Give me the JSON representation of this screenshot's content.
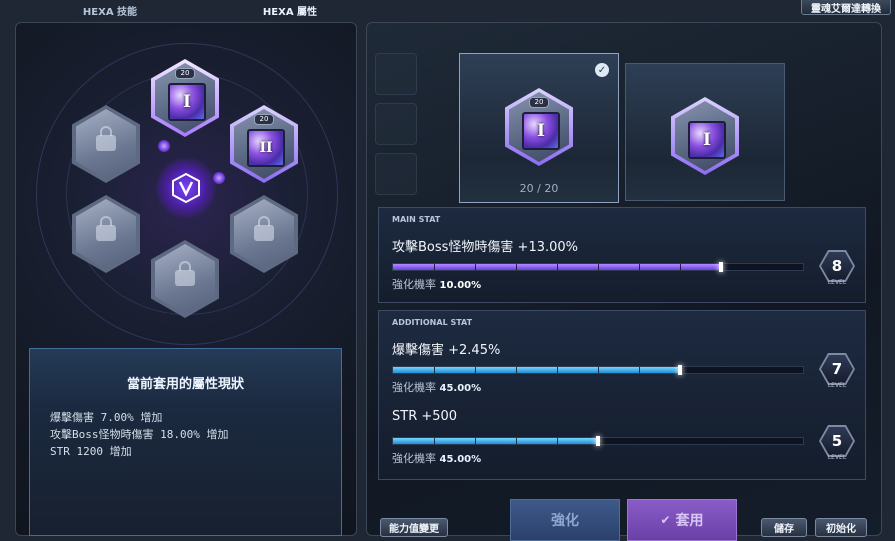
{
  "tabs": [
    {
      "label": "HEXA 技能",
      "active": false
    },
    {
      "label": "HEXA 屬性",
      "active": true
    }
  ],
  "top_button": "靈魂艾爾達轉換",
  "nodes": [
    {
      "state": "selected",
      "level": "20",
      "numeral": "I"
    },
    {
      "state": "active",
      "level": "20",
      "numeral": "II"
    },
    {
      "state": "locked"
    },
    {
      "state": "locked"
    },
    {
      "state": "locked"
    },
    {
      "state": "locked"
    }
  ],
  "current_stats": {
    "title": "當前套用的屬性現狀",
    "lines": [
      "爆擊傷害 7.00% 增加",
      "攻擊Boss怪物時傷害 18.00% 增加",
      "STR 1200 增加"
    ]
  },
  "buttons": {
    "stat_change": "能力值變更",
    "enhance": "強化",
    "apply": "套用",
    "save": "儲存",
    "reset": "初始化"
  },
  "preview": {
    "card_a": {
      "level": "20",
      "numeral": "I",
      "selected": true
    },
    "card_b": {
      "level": "",
      "numeral": "I"
    },
    "count": "20 / 20"
  },
  "main_stat": {
    "section_label": "MAIN STAT",
    "name": "攻擊Boss怪物時傷害 +13.00%",
    "rate_label": "強化機率",
    "rate_value": "10.00%",
    "level": "8",
    "level_label": "LEVEL",
    "progress": 0.8
  },
  "additional_stat": {
    "section_label": "ADDITIONAL STAT",
    "stats": [
      {
        "name": "爆擊傷害 +2.45%",
        "rate_label": "強化機率",
        "rate_value": "45.00%",
        "level": "7",
        "level_label": "LEVEL",
        "progress": 0.7
      },
      {
        "name": "STR +500",
        "rate_label": "強化機率",
        "rate_value": "45.00%",
        "level": "5",
        "level_label": "LEVEL",
        "progress": 0.5
      }
    ]
  },
  "colors": {
    "main_bar": "#8a5cf0",
    "additional_bar": "#2aa3e8",
    "accent_purple": "#a07cff"
  }
}
